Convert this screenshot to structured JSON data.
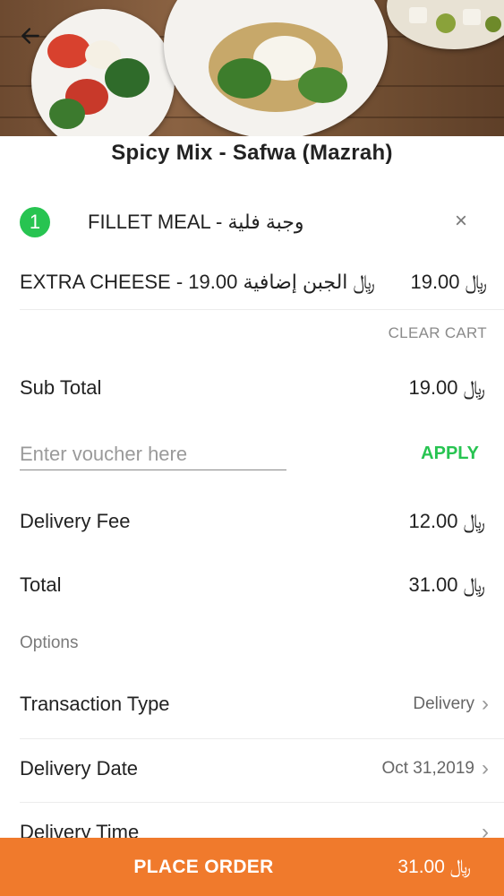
{
  "header": {
    "back_icon": "arrow-left-icon"
  },
  "store": {
    "title": "Spicy Mix - Safwa (Mazrah)"
  },
  "cart": {
    "item": {
      "quantity": "1",
      "name": "FILLET MEAL - وجبة فلية"
    },
    "addon": {
      "name": "EXTRA CHEESE - 19.00 ﷼ الجبن إضافية",
      "price": "19.00 ﷼"
    },
    "clear_label": "CLEAR CART"
  },
  "summary": {
    "subtotal_label": "Sub Total",
    "subtotal_value": "19.00 ﷼",
    "voucher_placeholder": "Enter voucher here",
    "apply_label": "APPLY",
    "delivery_fee_label": "Delivery Fee",
    "delivery_fee_value": "12.00 ﷼",
    "total_label": "Total",
    "total_value": "31.00 ﷼"
  },
  "options": {
    "section_label": "Options",
    "transaction_type_label": "Transaction Type",
    "transaction_type_value": "Delivery",
    "delivery_date_label": "Delivery Date",
    "delivery_date_value": "Oct 31,2019",
    "delivery_time_label": "Delivery Time"
  },
  "footer": {
    "place_order_label": "PLACE ORDER",
    "total": "31.00 ﷼"
  },
  "colors": {
    "accent_orange": "#f07a2c",
    "accent_green": "#27c451"
  }
}
